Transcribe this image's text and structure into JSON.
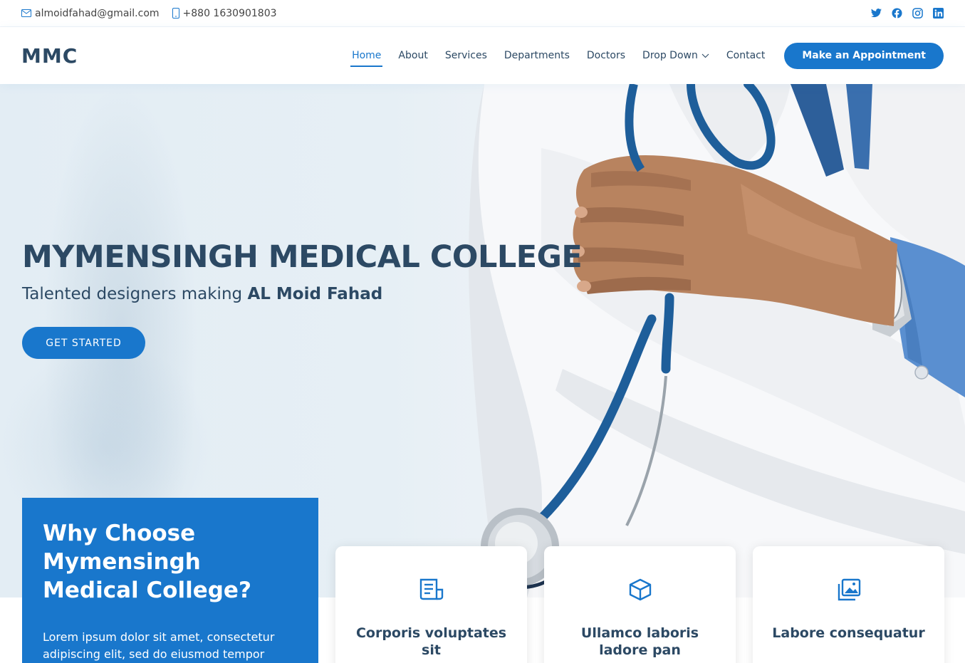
{
  "topbar": {
    "email": "almoidfahad@gmail.com",
    "phone": "+880 1630901803",
    "social": [
      "twitter-icon",
      "facebook-icon",
      "instagram-icon",
      "linkedin-icon"
    ]
  },
  "header": {
    "logo": "MMC",
    "nav": [
      "Home",
      "About",
      "Services",
      "Departments",
      "Doctors",
      "Drop Down",
      "Contact"
    ],
    "active_nav": "Home",
    "cta": "Make an Appointment"
  },
  "hero": {
    "title": "MYMENSINGH MEDICAL COLLEGE",
    "subtitle_prefix": "Talented designers making ",
    "subtitle_bold": "AL Moid Fahad",
    "button": "GET STARTED"
  },
  "why": {
    "title": "Why Choose Mymensingh Medical College?",
    "text": "Lorem ipsum dolor sit amet, consectetur adipiscing elit, sed do eiusmod tempor"
  },
  "cards": [
    {
      "icon": "receipt-icon",
      "title": "Corporis voluptates sit"
    },
    {
      "icon": "cube-icon",
      "title": "Ullamco laboris ladore pan"
    },
    {
      "icon": "images-icon",
      "title": "Labore consequatur"
    }
  ],
  "colors": {
    "accent": "#1977cc",
    "heading": "#2c4964",
    "text": "#444444"
  }
}
